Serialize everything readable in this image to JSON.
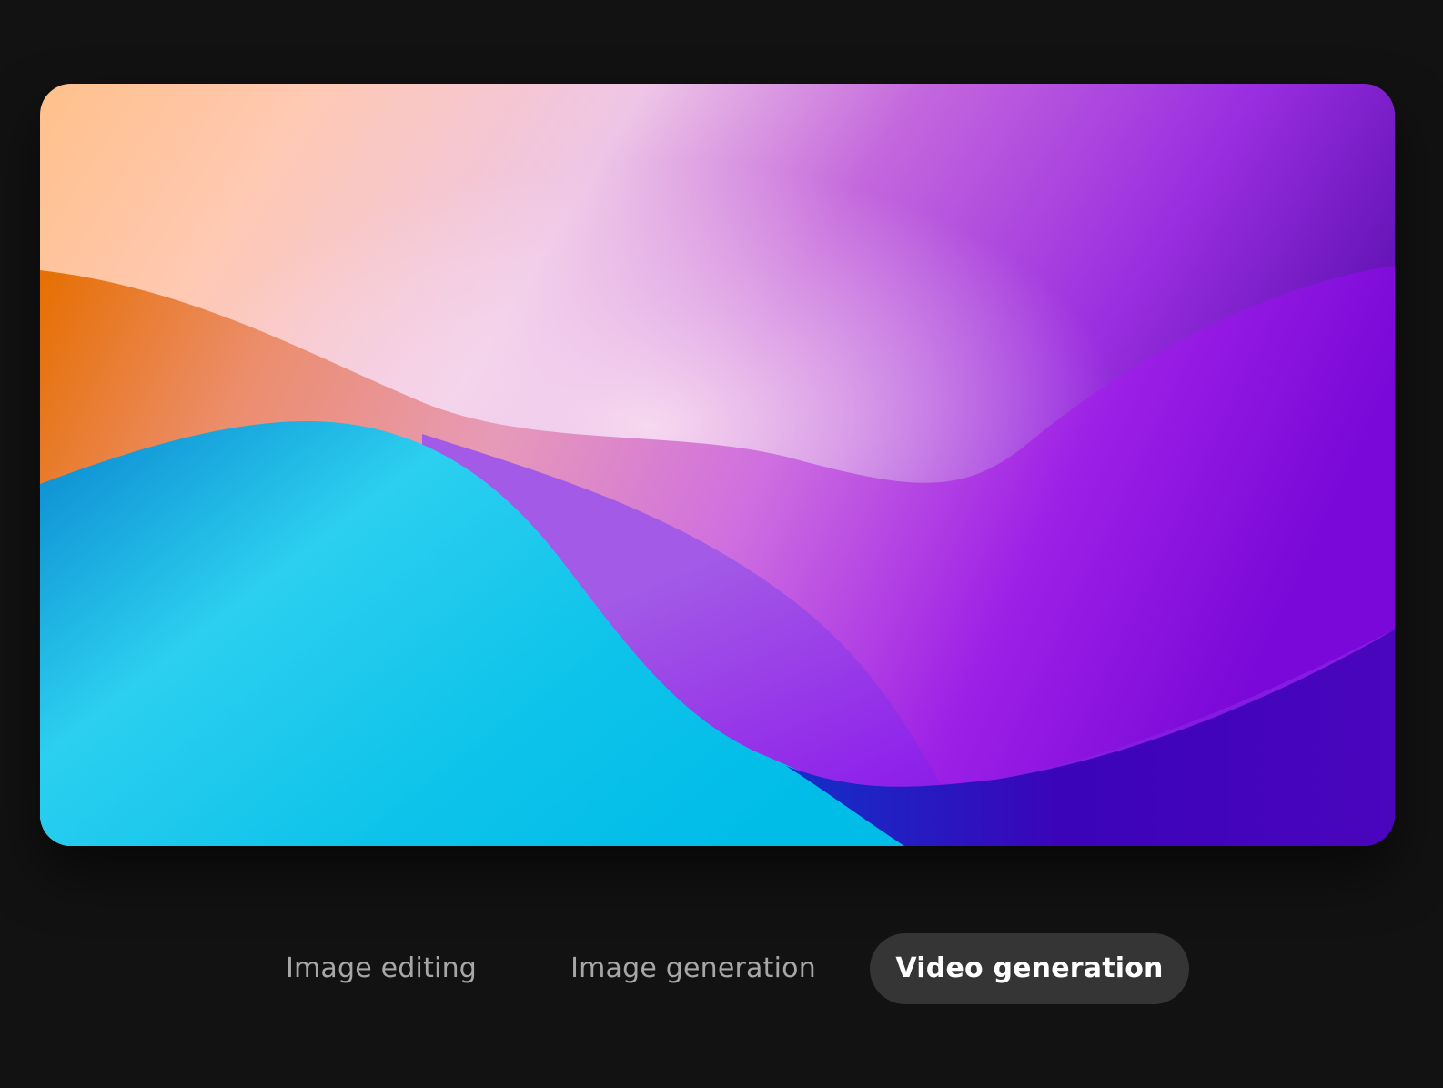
{
  "preview": {
    "image_name": "abstract-gradient-waves"
  },
  "tabs": [
    {
      "label": "Image editing",
      "selected": false
    },
    {
      "label": "Image generation",
      "selected": false
    },
    {
      "label": "Video generation",
      "selected": true
    }
  ],
  "colors": {
    "background": "#121212",
    "selected_tab_bg": "#353535",
    "selected_tab_text": "#ffffff",
    "tab_text": "#a7a7a7"
  }
}
